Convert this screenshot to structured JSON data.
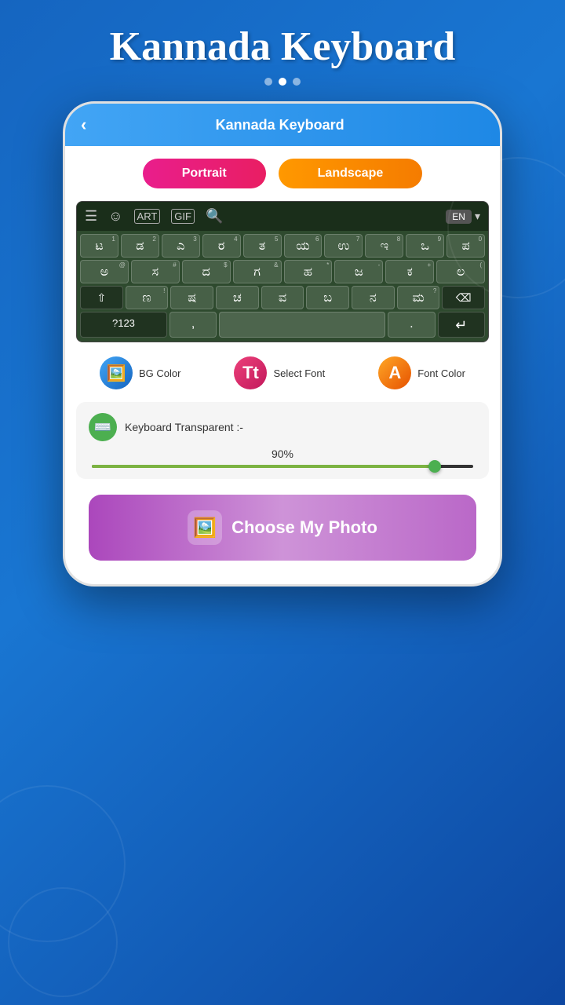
{
  "app": {
    "title": "Kannada Keyboard",
    "header_title": "Kannada Keyboard"
  },
  "dots": [
    "",
    "active",
    ""
  ],
  "tabs": {
    "portrait": "Portrait",
    "landscape": "Landscape"
  },
  "keyboard": {
    "lang": "EN",
    "row1": [
      {
        "char": "ಟ",
        "num": "1"
      },
      {
        "char": "ಡ",
        "num": "2"
      },
      {
        "char": "ಎ",
        "num": "3"
      },
      {
        "char": "ರ",
        "num": "4"
      },
      {
        "char": "ತ",
        "num": "5"
      },
      {
        "char": "ಯ",
        "num": "6"
      },
      {
        "char": "ಉ",
        "num": "7"
      },
      {
        "char": "ಇ",
        "num": "8"
      },
      {
        "char": "ಒ",
        "num": "9"
      },
      {
        "char": "ಪ",
        "num": "0"
      }
    ],
    "row2": [
      {
        "char": "ಅ",
        "sym": "@"
      },
      {
        "char": "ಸ",
        "sym": "#"
      },
      {
        "char": "ದ",
        "sym": "$"
      },
      {
        "char": "ಗ",
        "sym": "&"
      },
      {
        "char": "ಹ",
        "sym": "*"
      },
      {
        "char": "ಜ",
        "sym": "-"
      },
      {
        "char": "ಕ",
        "sym": "+"
      },
      {
        "char": "ಲ",
        "sym": "("
      }
    ],
    "row3": [
      {
        "char": "⇧",
        "special": true
      },
      {
        "char": "ಣ",
        "sym": "!"
      },
      {
        "char": "ಷ",
        "sym": ""
      },
      {
        "char": "ಚ",
        "sym": ""
      },
      {
        "char": "ವ",
        "sym": ""
      },
      {
        "char": "ಬ",
        "sym": ""
      },
      {
        "char": "ನ",
        "sym": ""
      },
      {
        "char": "ಮ",
        "sym": "?"
      },
      {
        "char": "⌫",
        "special": true
      }
    ],
    "row4": [
      {
        "char": "?123",
        "special": true
      },
      {
        "char": ","
      },
      {
        "char": "     ",
        "space": true
      },
      {
        "char": "."
      },
      {
        "char": "↵",
        "special": true
      }
    ]
  },
  "tools": {
    "bg_color": "BG Color",
    "select_font": "Select Font",
    "font_color": "Font Color"
  },
  "slider": {
    "title": "Keyboard Transparent :-",
    "value": "90%",
    "percent": 90
  },
  "choose_photo": {
    "label": "Choose My Photo"
  },
  "back_button": "‹"
}
